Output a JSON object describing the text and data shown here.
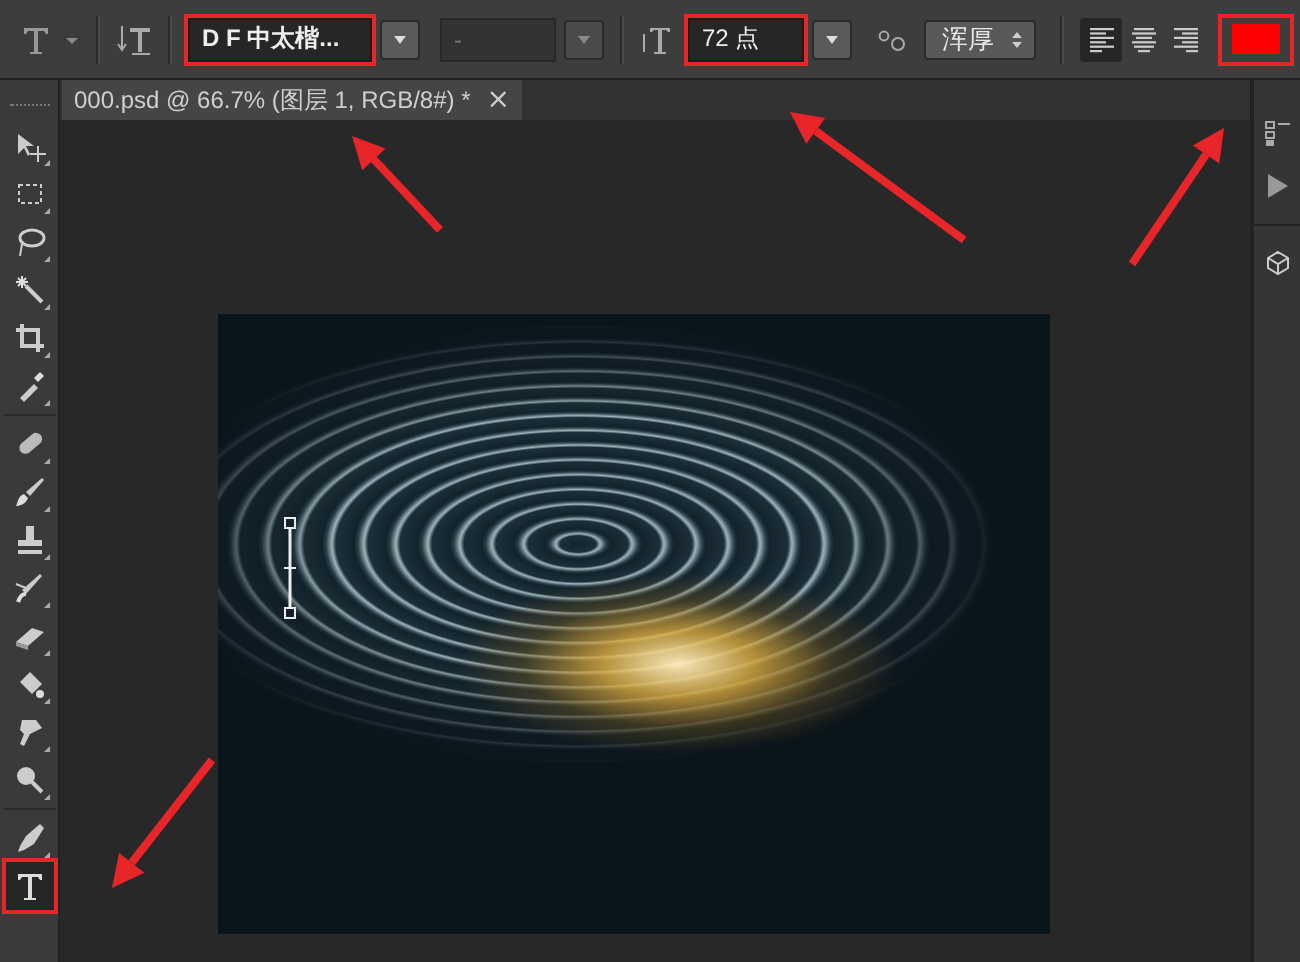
{
  "options_bar": {
    "font_family": {
      "value": "D F 中太楷...",
      "highlighted": true
    },
    "font_style": {
      "value": "-",
      "disabled": true
    },
    "font_size": {
      "value": "72 点",
      "highlighted": true
    },
    "antialias": {
      "value": "浑厚"
    },
    "alignment": [
      {
        "kind": "left",
        "selected": true
      },
      {
        "kind": "center",
        "selected": false
      },
      {
        "kind": "right",
        "selected": false
      }
    ],
    "text_color": {
      "color": "#ff0000",
      "highlighted": true
    }
  },
  "document_tab": {
    "title": "000.psd @ 66.7% (图层 1, RGB/8#) *",
    "close": "×"
  },
  "tools": [
    {
      "kind": "move",
      "selected": false,
      "highlighted": false
    },
    {
      "kind": "marquee",
      "selected": false,
      "highlighted": false
    },
    {
      "kind": "lasso",
      "selected": false,
      "highlighted": false
    },
    {
      "kind": "wand",
      "selected": false,
      "highlighted": false
    },
    {
      "kind": "crop",
      "selected": false,
      "highlighted": false
    },
    {
      "kind": "eyedropper",
      "selected": false,
      "highlighted": false
    },
    {
      "kind": "healing",
      "selected": false,
      "highlighted": false
    },
    {
      "kind": "brush",
      "selected": false,
      "highlighted": false
    },
    {
      "kind": "stamp",
      "selected": false,
      "highlighted": false
    },
    {
      "kind": "history",
      "selected": false,
      "highlighted": false
    },
    {
      "kind": "eraser",
      "selected": false,
      "highlighted": false
    },
    {
      "kind": "bucket",
      "selected": false,
      "highlighted": false
    },
    {
      "kind": "smudge",
      "selected": false,
      "highlighted": false
    },
    {
      "kind": "dodge",
      "selected": false,
      "highlighted": false
    },
    {
      "kind": "pen",
      "selected": false,
      "highlighted": false
    },
    {
      "kind": "type",
      "selected": true,
      "highlighted": true
    }
  ]
}
